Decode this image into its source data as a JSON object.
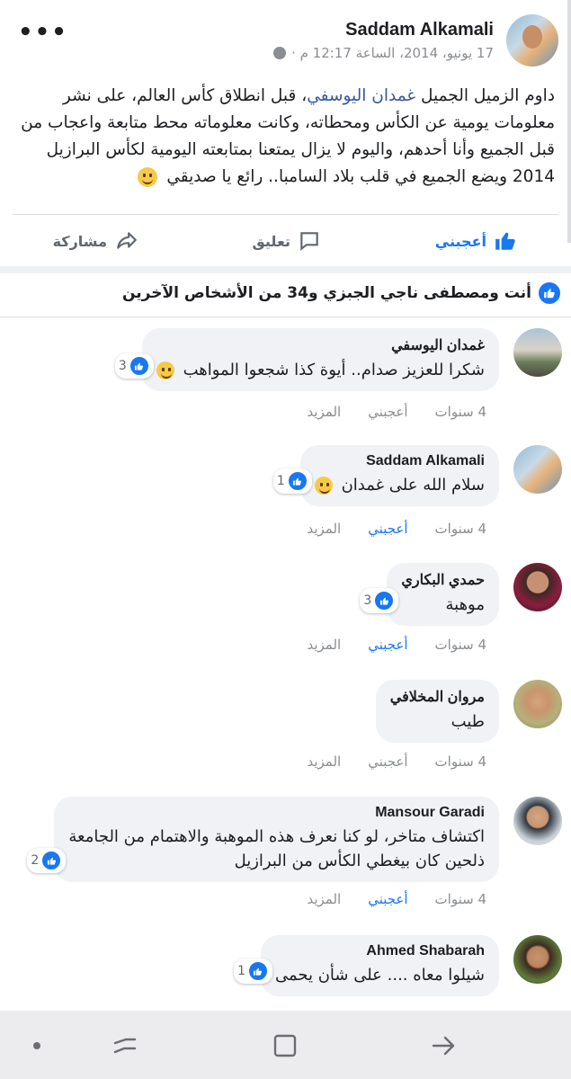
{
  "post": {
    "author": "Saddam Alkamali",
    "date": "17 يونيو، 2014، الساعة 12:17 م ·",
    "body_before": "داوم الزميل الجميل ",
    "mention": "غمدان اليوسفي",
    "body_after": "، قبل انطلاق كأس العالم، على نشر معلومات يومية عن الكأس ومحطاته، وكانت معلوماته محط متابعة واعجاب من قبل الجميع وأنا أحدهم، واليوم لا يزال يمتعنا بمتابعته اليومية لكأس البرازيل 2014 ويضع الجميع في قلب بلاد السامبا.. رائع يا صديقي ",
    "actions": {
      "like": "أعجبني",
      "comment": "تعليق",
      "share": "مشاركة"
    }
  },
  "reactions_summary": "أنت ومصطفى ناجي الجبزي و34 من الأشخاص الآخرين",
  "comments": [
    {
      "name": "غمدان اليوسفي",
      "text": "شكرا للعزيز صدام.. أيوة كذا شجعوا المواهب",
      "likes": "3",
      "time": "4 سنوات",
      "like": "أعجبني",
      "more": "المزيد"
    },
    {
      "name": "Saddam Alkamali",
      "text": "سلام الله على غمدان",
      "likes": "1",
      "time": "4 سنوات",
      "like": "أعجبني",
      "more": "المزيد"
    },
    {
      "name": "حمدي البكاري",
      "text": "موهبة",
      "likes": "3",
      "time": "4 سنوات",
      "like": "أعجبني",
      "more": "المزيد"
    },
    {
      "name": "مروان المخلافي",
      "text": "طيب",
      "likes": "",
      "time": "4 سنوات",
      "like": "أعجبني",
      "more": "المزيد"
    },
    {
      "name": "Mansour Garadi",
      "text_line1": "اكتشاف متاخر، لو كنا نعرف هذه الموهبة والاهتمام من الجامعة",
      "text_line2": "ذلحين كان بيغطي الكأس من البرازيل",
      "likes": "2",
      "time": "4 سنوات",
      "like": "أعجبني",
      "more": "المزيد"
    },
    {
      "name": "Ahmed Shabarah",
      "text": "شيلوا معاه .... على شأن يحمى",
      "likes": "1"
    }
  ],
  "colors": {
    "brand": "#1877f2",
    "bubble": "#f0f2f5",
    "meta": "#8a8d91"
  }
}
